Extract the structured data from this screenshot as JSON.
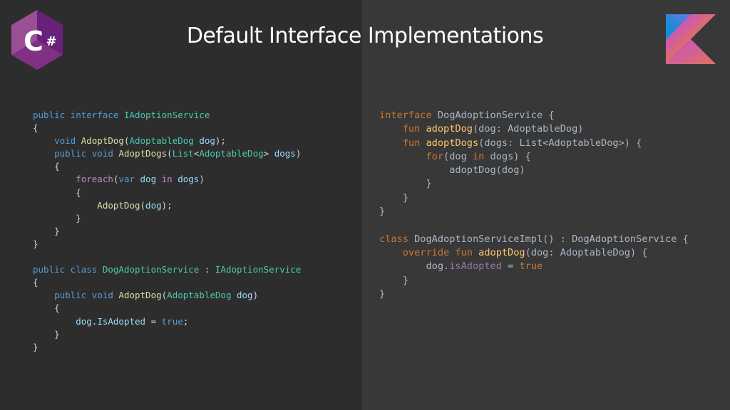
{
  "slide": {
    "title": "Default Interface Implementations"
  },
  "logos": {
    "left": "csharp-logo",
    "right": "kotlin-logo",
    "csharp_letter": "C",
    "csharp_hash": "#"
  },
  "colors": {
    "background_left": "#2d2d2d",
    "background_right": "#383838",
    "title": "#ffffff",
    "cs_keyword": "#569cd6",
    "cs_type": "#4ec9b0",
    "cs_method": "#dcdcaa",
    "cs_variable": "#9cdcfe",
    "cs_control": "#c586c0",
    "kt_keyword": "#cc7832",
    "kt_function": "#ffc66d",
    "kt_property": "#9876aa"
  },
  "csharp_code": [
    [
      {
        "t": "public interface ",
        "c": "#569cd6"
      },
      {
        "t": "IAdoptionService",
        "c": "#4ec9b0"
      }
    ],
    [
      {
        "t": "{",
        "c": "#d4d4d4"
      }
    ],
    [
      {
        "t": "    void ",
        "c": "#569cd6"
      },
      {
        "t": "AdoptDog",
        "c": "#dcdcaa"
      },
      {
        "t": "(",
        "c": "#d4d4d4"
      },
      {
        "t": "AdoptableDog",
        "c": "#4ec9b0"
      },
      {
        "t": " dog",
        "c": "#9cdcfe"
      },
      {
        "t": ");",
        "c": "#d4d4d4"
      }
    ],
    [
      {
        "t": "    public void ",
        "c": "#569cd6"
      },
      {
        "t": "AdoptDogs",
        "c": "#dcdcaa"
      },
      {
        "t": "(",
        "c": "#d4d4d4"
      },
      {
        "t": "List",
        "c": "#4ec9b0"
      },
      {
        "t": "<",
        "c": "#d4d4d4"
      },
      {
        "t": "AdoptableDog",
        "c": "#4ec9b0"
      },
      {
        "t": "> ",
        "c": "#d4d4d4"
      },
      {
        "t": "dogs",
        "c": "#9cdcfe"
      },
      {
        "t": ")",
        "c": "#d4d4d4"
      }
    ],
    [
      {
        "t": "    {",
        "c": "#d4d4d4"
      }
    ],
    [
      {
        "t": "        foreach",
        "c": "#c586c0"
      },
      {
        "t": "(",
        "c": "#d4d4d4"
      },
      {
        "t": "var ",
        "c": "#569cd6"
      },
      {
        "t": "dog ",
        "c": "#9cdcfe"
      },
      {
        "t": "in ",
        "c": "#c586c0"
      },
      {
        "t": "dogs",
        "c": "#9cdcfe"
      },
      {
        "t": ")",
        "c": "#d4d4d4"
      }
    ],
    [
      {
        "t": "        {",
        "c": "#d4d4d4"
      }
    ],
    [
      {
        "t": "            AdoptDog",
        "c": "#dcdcaa"
      },
      {
        "t": "(",
        "c": "#d4d4d4"
      },
      {
        "t": "dog",
        "c": "#9cdcfe"
      },
      {
        "t": ");",
        "c": "#d4d4d4"
      }
    ],
    [
      {
        "t": "        }",
        "c": "#d4d4d4"
      }
    ],
    [
      {
        "t": "    }",
        "c": "#d4d4d4"
      }
    ],
    [
      {
        "t": "}",
        "c": "#d4d4d4"
      }
    ],
    [
      {
        "t": " ",
        "c": "#d4d4d4"
      }
    ],
    [
      {
        "t": "public class ",
        "c": "#569cd6"
      },
      {
        "t": "DogAdoptionService",
        "c": "#4ec9b0"
      },
      {
        "t": " : ",
        "c": "#d4d4d4"
      },
      {
        "t": "IAdoptionService",
        "c": "#4ec9b0"
      }
    ],
    [
      {
        "t": "{",
        "c": "#d4d4d4"
      }
    ],
    [
      {
        "t": "    public void ",
        "c": "#569cd6"
      },
      {
        "t": "AdoptDog",
        "c": "#dcdcaa"
      },
      {
        "t": "(",
        "c": "#d4d4d4"
      },
      {
        "t": "AdoptableDog",
        "c": "#4ec9b0"
      },
      {
        "t": " dog",
        "c": "#9cdcfe"
      },
      {
        "t": ")",
        "c": "#d4d4d4"
      }
    ],
    [
      {
        "t": "    {",
        "c": "#d4d4d4"
      }
    ],
    [
      {
        "t": "        dog",
        "c": "#9cdcfe"
      },
      {
        "t": ".",
        "c": "#d4d4d4"
      },
      {
        "t": "IsAdopted",
        "c": "#9cdcfe"
      },
      {
        "t": " = ",
        "c": "#d4d4d4"
      },
      {
        "t": "true",
        "c": "#569cd6"
      },
      {
        "t": ";",
        "c": "#d4d4d4"
      }
    ],
    [
      {
        "t": "    }",
        "c": "#d4d4d4"
      }
    ],
    [
      {
        "t": "}",
        "c": "#d4d4d4"
      }
    ]
  ],
  "kotlin_code": [
    [
      {
        "t": "interface ",
        "c": "#cc7832"
      },
      {
        "t": "DogAdoptionService {",
        "c": "#a9b7c6"
      }
    ],
    [
      {
        "t": "    fun ",
        "c": "#cc7832"
      },
      {
        "t": "adoptDog",
        "c": "#ffc66d"
      },
      {
        "t": "(dog: AdoptableDog)",
        "c": "#a9b7c6"
      }
    ],
    [
      {
        "t": "    fun ",
        "c": "#cc7832"
      },
      {
        "t": "adoptDogs",
        "c": "#ffc66d"
      },
      {
        "t": "(dogs: List<AdoptableDog>) {",
        "c": "#a9b7c6"
      }
    ],
    [
      {
        "t": "        for",
        "c": "#cc7832"
      },
      {
        "t": "(dog ",
        "c": "#a9b7c6"
      },
      {
        "t": "in ",
        "c": "#cc7832"
      },
      {
        "t": "dogs) {",
        "c": "#a9b7c6"
      }
    ],
    [
      {
        "t": "            adoptDog(dog)",
        "c": "#a9b7c6"
      }
    ],
    [
      {
        "t": "        }",
        "c": "#a9b7c6"
      }
    ],
    [
      {
        "t": "    }",
        "c": "#a9b7c6"
      }
    ],
    [
      {
        "t": "}",
        "c": "#a9b7c6"
      }
    ],
    [
      {
        "t": " ",
        "c": "#a9b7c6"
      }
    ],
    [
      {
        "t": "class ",
        "c": "#cc7832"
      },
      {
        "t": "DogAdoptionServiceImpl() : DogAdoptionService {",
        "c": "#a9b7c6"
      }
    ],
    [
      {
        "t": "    override fun ",
        "c": "#cc7832"
      },
      {
        "t": "adoptDog",
        "c": "#ffc66d"
      },
      {
        "t": "(dog: AdoptableDog) {",
        "c": "#a9b7c6"
      }
    ],
    [
      {
        "t": "        dog.",
        "c": "#a9b7c6"
      },
      {
        "t": "isAdopted",
        "c": "#9876aa"
      },
      {
        "t": " = ",
        "c": "#a9b7c6"
      },
      {
        "t": "true",
        "c": "#cc7832"
      }
    ],
    [
      {
        "t": "    }",
        "c": "#a9b7c6"
      }
    ],
    [
      {
        "t": "}",
        "c": "#a9b7c6"
      }
    ]
  ]
}
